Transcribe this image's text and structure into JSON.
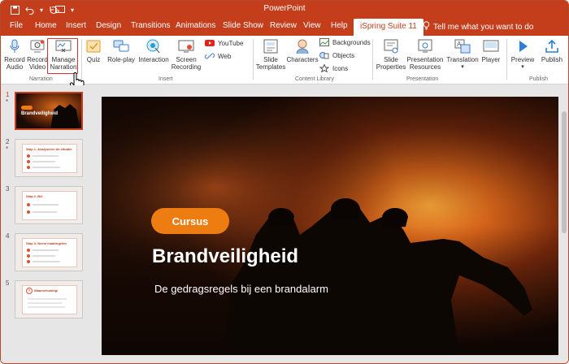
{
  "window": {
    "title": "PowerPoint"
  },
  "quick_access": {
    "save_icon": "save-icon",
    "undo_icon": "undo-icon",
    "redo_icon": "redo-icon",
    "from_beginning_icon": "slideshow-from-start-icon",
    "more_icon": "customize-quick-access-icon"
  },
  "tabs": [
    {
      "label": "File"
    },
    {
      "label": "Home"
    },
    {
      "label": "Insert"
    },
    {
      "label": "Design"
    },
    {
      "label": "Transitions"
    },
    {
      "label": "Animations"
    },
    {
      "label": "Slide Show"
    },
    {
      "label": "Review"
    },
    {
      "label": "View"
    },
    {
      "label": "Help"
    },
    {
      "label": "iSpring Suite 11",
      "active": true
    }
  ],
  "tell_me": {
    "placeholder": "Tell me what you want to do",
    "icon": "lightbulb-icon"
  },
  "ribbon": {
    "narration": {
      "group_label": "Narration",
      "record_audio": "Record Audio",
      "record_audio_l1": "Record",
      "record_audio_l2": "Audio",
      "record_video_l1": "Record",
      "record_video_l2": "Video",
      "manage_l1": "Manage",
      "manage_l2": "Narration"
    },
    "insert": {
      "group_label": "Insert",
      "quiz": "Quiz",
      "roleplay": "Role-play",
      "interaction": "Interaction",
      "screen_l1": "Screen",
      "screen_l2": "Recording",
      "youtube": "YouTube",
      "web": "Web"
    },
    "content_library": {
      "group_label": "Content Library",
      "templates_l1": "Slide",
      "templates_l2": "Templates",
      "characters": "Characters",
      "backgrounds": "Backgrounds",
      "objects": "Objects",
      "icons": "Icons"
    },
    "presentation": {
      "group_label": "Presentation",
      "props_l1": "Slide",
      "props_l2": "Properties",
      "resources_l1": "Presentation",
      "resources_l2": "Resources",
      "translation": "Translation",
      "player": "Player"
    },
    "publish": {
      "group_label": "Publish",
      "preview": "Preview",
      "publish": "Publish"
    }
  },
  "slides": [
    {
      "number": "1",
      "starred": "*",
      "active": true
    },
    {
      "number": "2",
      "starred": "*"
    },
    {
      "number": "3",
      "starred": ""
    },
    {
      "number": "4",
      "starred": ""
    },
    {
      "number": "5",
      "starred": ""
    }
  ],
  "thumbs": {
    "t1_title": "Brandveiligheid",
    "t2_title": "Stap 1. Analyseren de situatie",
    "t3_title": "Stap 2. Bel",
    "t4_title": "Stap 3. Neem maatregelen",
    "t5_title": "Waarschuwing!"
  },
  "slide": {
    "pill": "Cursus",
    "title": "Brandveiligheid",
    "subtitle": "De gedragsregels bij een brandalarm"
  },
  "colors": {
    "accent": "#c43e1c",
    "pill": "#ee7d11",
    "highlight": "#d13438"
  }
}
